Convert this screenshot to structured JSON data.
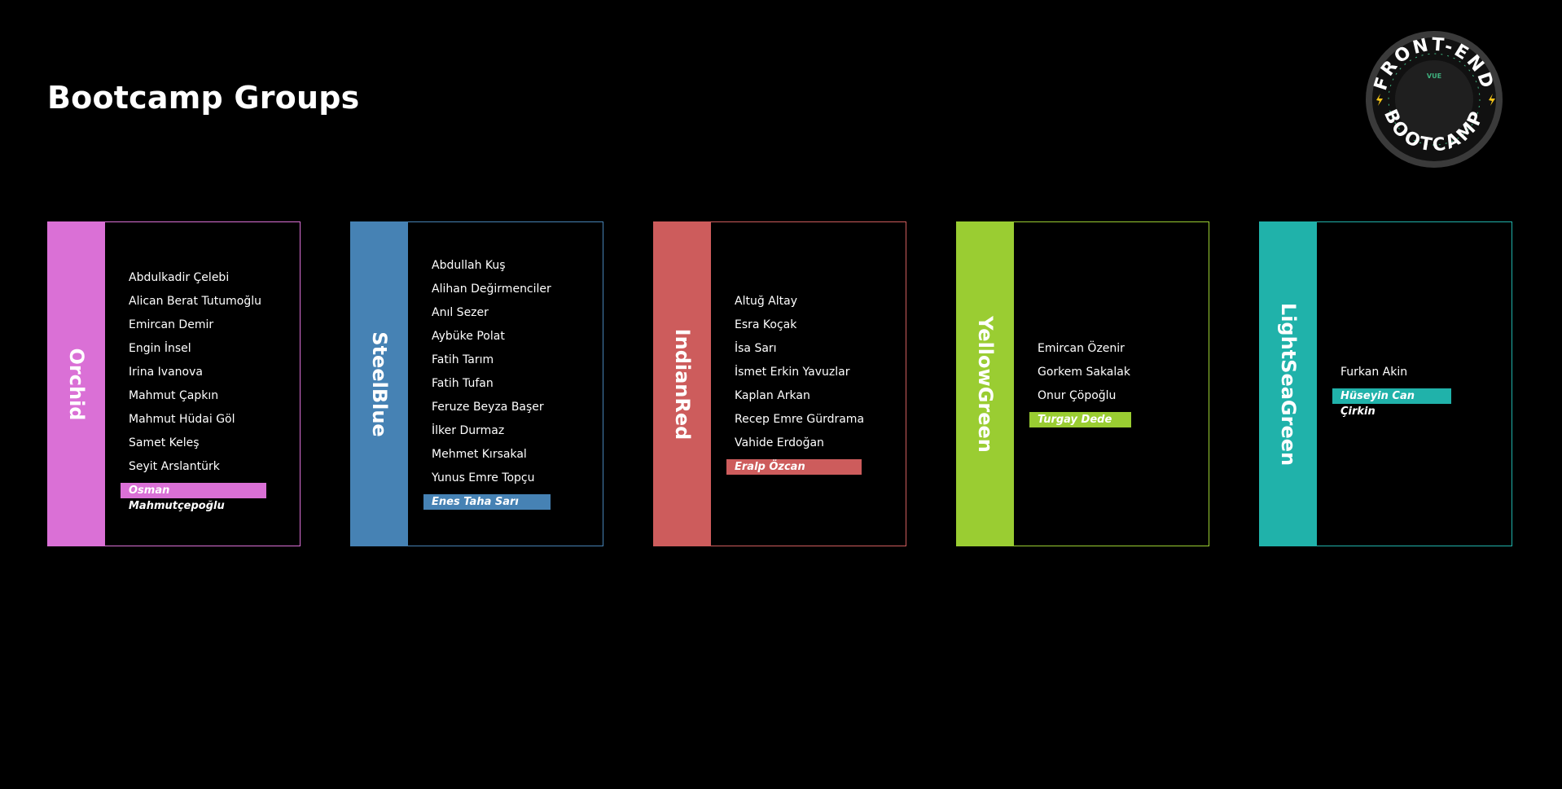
{
  "page": {
    "title": "Bootcamp Groups"
  },
  "logo": {
    "top_text": "FRONT-END",
    "bottom_text": "BOOTCAMP",
    "ring_text": "VUE"
  },
  "groups": [
    {
      "name": "Orchid",
      "color": "#DA70D6",
      "members": [
        "Abdulkadir Çelebi",
        "Alican Berat Tutumoğlu",
        "Emircan Demir",
        "Engin İnsel",
        "Irina Ivanova",
        "Mahmut Çapkın",
        "Mahmut Hüdai Göl",
        "Samet Keleş",
        "Seyit Arslantürk"
      ],
      "mentor": "Osman Mahmutçepoğlu"
    },
    {
      "name": "SteelBlue",
      "color": "#4682B4",
      "members": [
        "Abdullah Kuş",
        "Alihan Değirmenciler",
        "Anıl Sezer",
        "Aybüke Polat",
        "Fatih Tarım",
        "Fatih Tufan",
        "Feruze Beyza Başer",
        "İlker Durmaz",
        "Mehmet Kırsakal",
        "Yunus Emre Topçu"
      ],
      "mentor": "Enes Taha Sarı"
    },
    {
      "name": "IndianRed",
      "color": "#CD5C5C",
      "members": [
        "Altuğ Altay",
        "Esra Koçak",
        "İsa Sarı",
        "İsmet Erkin Yavuzlar",
        "Kaplan Arkan",
        "Recep Emre Gürdrama",
        "Vahide Erdoğan"
      ],
      "mentor": "Eralp Özcan"
    },
    {
      "name": "YellowGreen",
      "color": "#9ACD32",
      "members": [
        "Emircan Özenir",
        "Gorkem Sakalak",
        "Onur Çöpoğlu"
      ],
      "mentor": "Turgay Dede"
    },
    {
      "name": "LightSeaGreen",
      "color": "#20B2AA",
      "members": [
        "Furkan Akin"
      ],
      "mentor": "Hüseyin Can Çirkin"
    }
  ]
}
